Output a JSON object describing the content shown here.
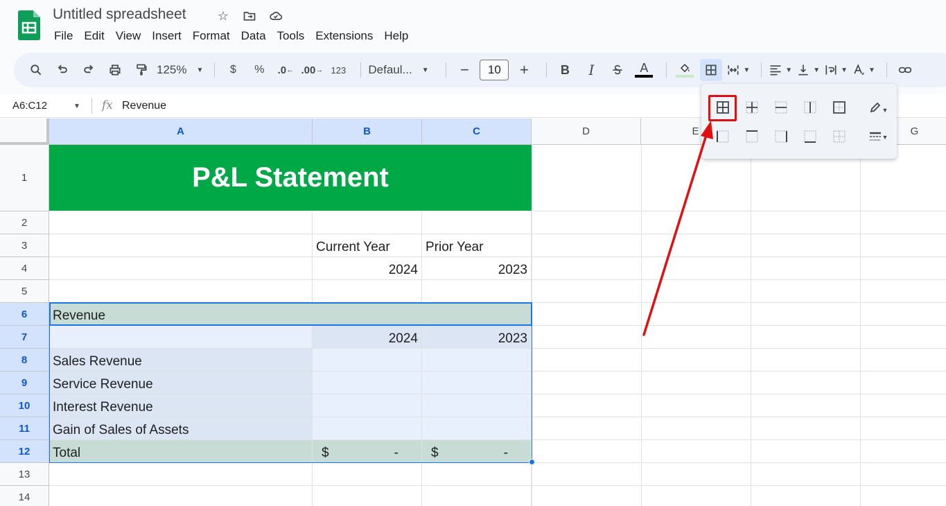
{
  "app": {
    "doc_title": "Untitled spreadsheet",
    "menu": [
      "File",
      "Edit",
      "View",
      "Insert",
      "Format",
      "Data",
      "Tools",
      "Extensions",
      "Help"
    ]
  },
  "toolbar": {
    "zoom": "125%",
    "currency": "$",
    "percent": "%",
    "decimal_decrease": ".0",
    "decimal_increase": ".00",
    "number_format": "123",
    "font": "Defaul...",
    "font_size": "10",
    "bold": "B",
    "italic": "I",
    "text_color": "A"
  },
  "formula_bar": {
    "name_box": "A6:C12",
    "fx": "fx",
    "formula": "Revenue"
  },
  "columns": [
    "A",
    "B",
    "C",
    "D",
    "E",
    "F",
    "G"
  ],
  "rows": [
    "1",
    "2",
    "3",
    "4",
    "5",
    "6",
    "7",
    "8",
    "9",
    "10",
    "11",
    "12",
    "13",
    "14"
  ],
  "sheet": {
    "title": "P&L Statement",
    "b3": "Current Year",
    "c3": "Prior Year",
    "b4": "2024",
    "c4": "2023",
    "a6": "Revenue",
    "b7": "2024",
    "c7": "2023",
    "a8": "Sales Revenue",
    "a9": "Service Revenue",
    "a10": "Interest Revenue",
    "a11": "Gain of Sales of Assets",
    "a12": "Total",
    "b12_sym": "$",
    "b12_val": "-",
    "c12_sym": "$",
    "c12_val": "-"
  },
  "colors": {
    "title_green": "#00a846",
    "band_green": "#c6dcd5",
    "selection_blue": "#1a73e8",
    "annotation_red": "#e01010"
  },
  "icons": {
    "logo": "sheets-logo-icon",
    "star": "star-icon",
    "move": "move-folder-icon",
    "cloud": "cloud-saved-icon"
  }
}
